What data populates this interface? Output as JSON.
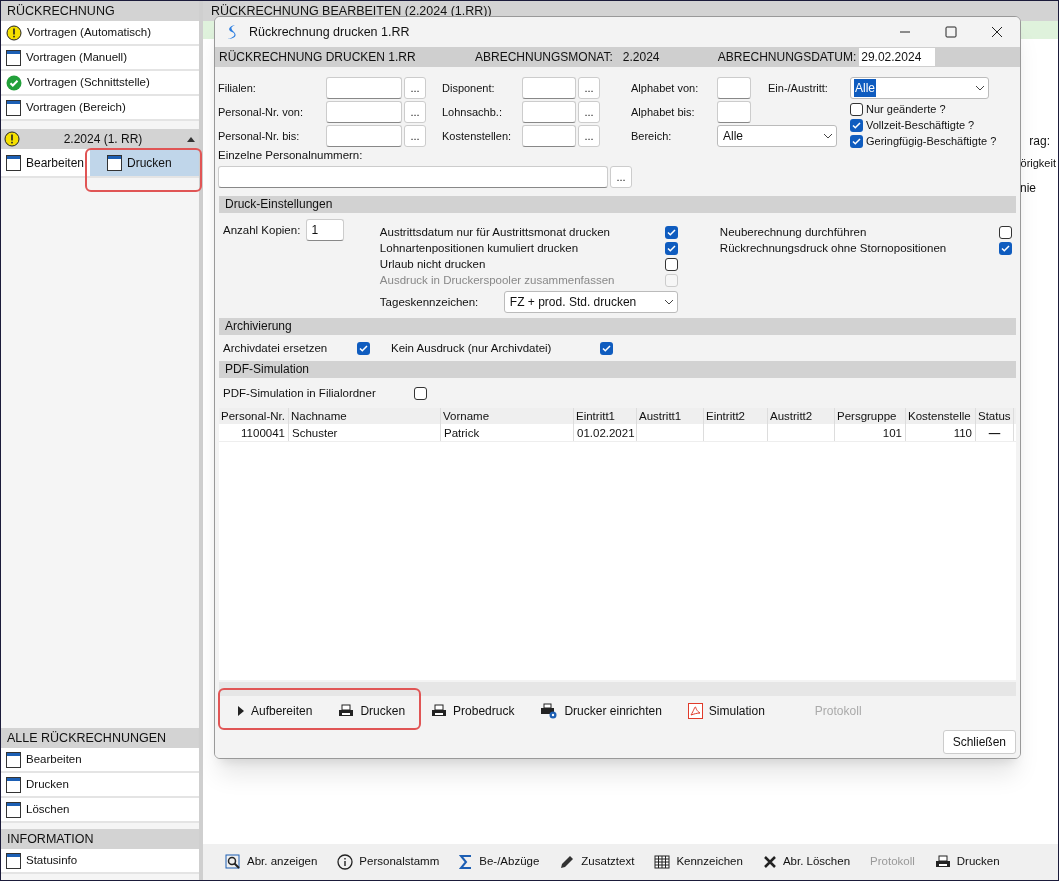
{
  "sidebar": {
    "sections": [
      {
        "title": "RÜCKRECHNUNG",
        "items": [
          {
            "label": "Vortragen (Automatisch)",
            "kind": "warning",
            "selected": false
          },
          {
            "label": "Vortragen (Manuell)",
            "kind": "window",
            "selected": false
          },
          {
            "label": "Vortragen (Schnittstelle)",
            "kind": "check",
            "selected": false
          },
          {
            "label": "Vortragen (Bereich)",
            "kind": "window",
            "selected": false
          }
        ]
      },
      {
        "title": "2.2024 (1. RR)",
        "kind": "warning",
        "expanded": true,
        "items": [
          {
            "label": "Bearbeiten",
            "kind": "window",
            "selected": false
          },
          {
            "label": "Drucken",
            "kind": "window",
            "selected": true
          }
        ]
      }
    ],
    "bottom_sections": [
      {
        "title": "ALLE RÜCKRECHNUNGEN",
        "items": [
          {
            "label": "Bearbeiten",
            "kind": "window",
            "selected": false
          },
          {
            "label": "Drucken",
            "kind": "window",
            "selected": false
          },
          {
            "label": "Löschen",
            "kind": "window",
            "selected": false
          }
        ]
      },
      {
        "title": "INFORMATION",
        "items": [
          {
            "label": "Statusinfo",
            "kind": "window",
            "selected": false
          }
        ]
      }
    ]
  },
  "main": {
    "title": "RÜCKRECHNUNG BEARBEITEN (2.2024 (1.RR))",
    "fragments": [
      "rag:",
      "örigkeit",
      "nie"
    ],
    "toolbar": [
      {
        "label": "Abr. anzeigen",
        "kind": "magnifier",
        "disabled": false
      },
      {
        "label": "Personalstamm",
        "kind": "info",
        "disabled": false
      },
      {
        "label": "Be-/Abzüge",
        "kind": "sigma",
        "disabled": false
      },
      {
        "label": "Zusatztext",
        "kind": "pencil",
        "disabled": false
      },
      {
        "label": "Kennzeichen",
        "kind": "grid",
        "disabled": false
      },
      {
        "label": "Abr. Löschen",
        "kind": "x",
        "disabled": false
      },
      {
        "label": "Protokoll",
        "kind": "text",
        "disabled": true
      },
      {
        "label": "Drucken",
        "kind": "printer",
        "disabled": false
      }
    ]
  },
  "dialog": {
    "title": "Rückrechnung drucken 1.RR",
    "header": {
      "label": "RÜCKRECHNUNG DRUCKEN 1.RR",
      "month_label": "ABRECHNUNGSMONAT:",
      "month": "2.2024",
      "date_label": "ABRECHNUNGSDATUM:",
      "date": "29.02.2024"
    },
    "filters": {
      "col1": [
        {
          "label": "Filialen:"
        },
        {
          "label": "Personal-Nr. von:"
        },
        {
          "label": "Personal-Nr. bis:"
        }
      ],
      "col2": [
        {
          "label": "Disponent:"
        },
        {
          "label": "Lohnsachb.:"
        },
        {
          "label": "Kostenstellen:"
        }
      ],
      "alpha_from": "Alphabet von:",
      "alpha_to": "Alphabet bis:",
      "bereich_label": "Bereich:",
      "bereich": "Alle",
      "einaus_label": "Ein-/Austritt:",
      "einaus": "Alle",
      "checks": [
        {
          "label": "Nur geänderte ?",
          "checked": false
        },
        {
          "label": "Vollzeit-Beschäftigte ?",
          "checked": true
        },
        {
          "label": "Geringfügig-Beschäftigte ?",
          "checked": true
        }
      ],
      "single_label": "Einzelne Personalnummern:",
      "browse": "..."
    },
    "print_settings": {
      "title": "Druck-Einstellungen",
      "copies_label": "Anzahl Kopien:",
      "copies": "1",
      "options": [
        {
          "label": "Austrittsdatum nur für Austrittsmonat drucken",
          "checked": true,
          "disabled": false
        },
        {
          "label": "Lohnartenpositionen kumuliert drucken",
          "checked": true,
          "disabled": false
        },
        {
          "label": "Urlaub nicht drucken",
          "checked": false,
          "disabled": false
        },
        {
          "label": "Ausdruck in Druckerspooler zusammenfassen",
          "checked": false,
          "disabled": true
        }
      ],
      "options_right": [
        {
          "label": "Neuberechnung durchführen",
          "checked": false
        },
        {
          "label": "Rückrechnungsdruck ohne Stornopositionen",
          "checked": true
        }
      ],
      "day_label": "Tageskennzeichen:",
      "day": "FZ + prod. Std. drucken"
    },
    "archive": {
      "title": "Archivierung",
      "options": [
        {
          "label": "Archivdatei ersetzen",
          "checked": true
        },
        {
          "label": "Kein Ausdruck (nur Archivdatei)",
          "checked": true
        }
      ]
    },
    "pdf": {
      "title": "PDF-Simulation",
      "option": {
        "label": "PDF-Simulation in Filialordner",
        "checked": false
      }
    },
    "table": {
      "columns": [
        "Personal-Nr.",
        "Nachname",
        "Vorname",
        "Eintritt1",
        "Austritt1",
        "Eintritt2",
        "Austritt2",
        "Persgruppe",
        "Kostenstelle",
        "Status"
      ],
      "rows": [
        [
          "1100041",
          "Schuster",
          "Patrick",
          "01.02.2021",
          "",
          "",
          "",
          "101",
          "110",
          "—"
        ]
      ]
    },
    "actions": [
      {
        "label": "Aufbereiten",
        "kind": "play",
        "disabled": false
      },
      {
        "label": "Drucken",
        "kind": "printer",
        "disabled": false
      },
      {
        "label": "Probedruck",
        "kind": "printer",
        "disabled": false
      },
      {
        "label": "Drucker einrichten",
        "kind": "printer-gear",
        "disabled": false
      },
      {
        "label": "Simulation",
        "kind": "pdf",
        "disabled": false
      },
      {
        "label": "Protokoll",
        "kind": "text",
        "disabled": true
      }
    ],
    "close": "Schließen"
  }
}
